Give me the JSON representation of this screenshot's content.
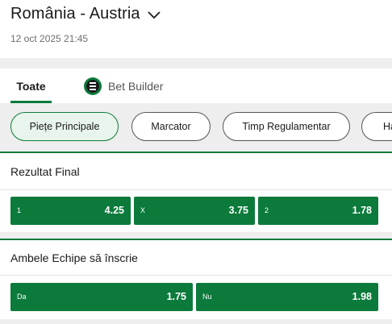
{
  "match": {
    "title": "România - Austria",
    "datetime": "12 oct 2025 21:45",
    "icon": "chevron-down-icon"
  },
  "tabs": [
    {
      "label": "Toate",
      "active": true
    },
    {
      "label": "Bet Builder",
      "icon": "bet-builder-icon",
      "active": false
    }
  ],
  "filters": [
    {
      "label": "Piețe Principale",
      "active": true
    },
    {
      "label": "Marcator",
      "active": false
    },
    {
      "label": "Timp Regulamentar",
      "active": false
    },
    {
      "label": "Ha",
      "active": false
    }
  ],
  "markets": [
    {
      "title": "Rezultat Final",
      "outcomes": [
        {
          "label": "1",
          "odds": "4.25"
        },
        {
          "label": "X",
          "odds": "3.75"
        },
        {
          "label": "2",
          "odds": "1.78"
        }
      ]
    },
    {
      "title": "Ambele Echipe să înscrie",
      "outcomes": [
        {
          "label": "Da",
          "odds": "1.75"
        },
        {
          "label": "Nu",
          "odds": "1.98"
        }
      ]
    }
  ],
  "colors": {
    "accent": "#0b7a3b",
    "background_gray": "#eeeeee"
  }
}
